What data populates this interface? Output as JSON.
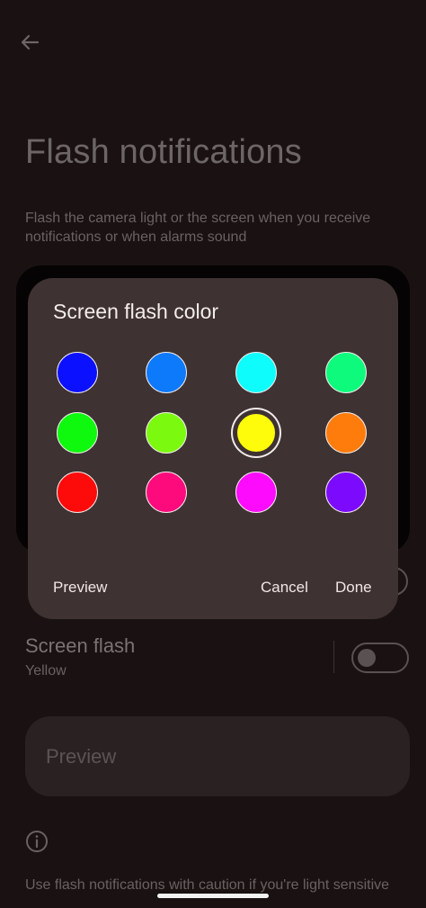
{
  "page": {
    "title": "Flash notifications",
    "description": "Flash the camera light or the screen when you receive notifications or when alarms sound",
    "screen_flash": {
      "label": "Screen flash",
      "value": "Yellow",
      "enabled": false
    },
    "preview_label": "Preview",
    "caution_text": "Use flash notifications with caution if you're light sensitive"
  },
  "dialog": {
    "title": "Screen flash color",
    "colors": [
      {
        "name": "blue",
        "hex": "#0b10ff"
      },
      {
        "name": "azure",
        "hex": "#0d79fb"
      },
      {
        "name": "cyan",
        "hex": "#0efcfc"
      },
      {
        "name": "spring-green",
        "hex": "#0efa7c"
      },
      {
        "name": "green",
        "hex": "#0ef90d"
      },
      {
        "name": "chartreuse",
        "hex": "#7bf90f"
      },
      {
        "name": "yellow",
        "hex": "#fefb0b",
        "selected": true
      },
      {
        "name": "orange",
        "hex": "#fd7c0b"
      },
      {
        "name": "red",
        "hex": "#fd0b0b"
      },
      {
        "name": "rose",
        "hex": "#fd0b7c"
      },
      {
        "name": "magenta",
        "hex": "#fd0bfc"
      },
      {
        "name": "violet",
        "hex": "#7c0bfd"
      }
    ],
    "buttons": {
      "preview": "Preview",
      "cancel": "Cancel",
      "done": "Done"
    }
  },
  "icons": {
    "back": "arrow-back-icon",
    "info": "info-icon"
  }
}
